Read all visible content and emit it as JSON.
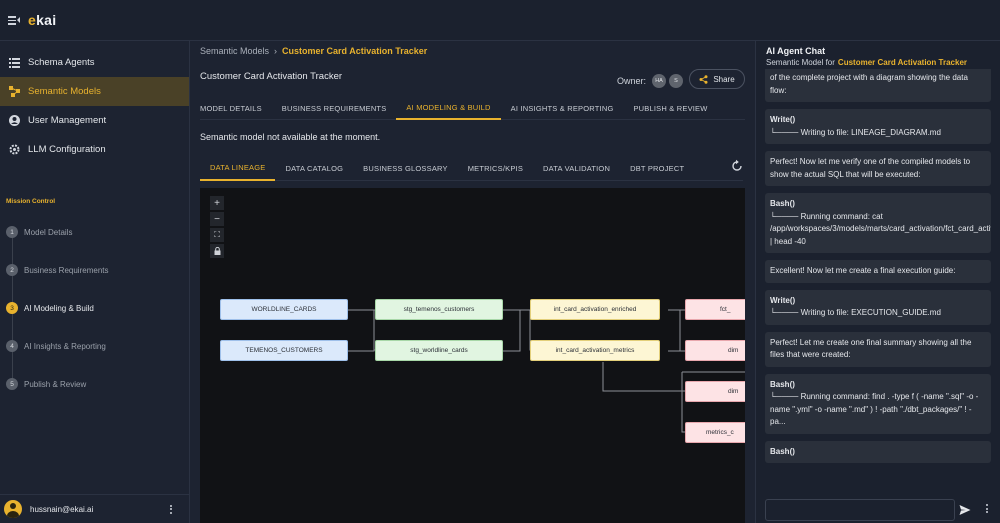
{
  "app": {
    "logo_e": "e",
    "logo_rest": "kai"
  },
  "sidebar": {
    "items": [
      {
        "label": "Schema Agents",
        "icon": "list-icon"
      },
      {
        "label": "Semantic Models",
        "icon": "nodes-icon",
        "active": true
      },
      {
        "label": "User Management",
        "icon": "user-icon"
      },
      {
        "label": "LLM Configuration",
        "icon": "gear-icon"
      }
    ],
    "mission_title": "Mission Control",
    "steps": [
      {
        "num": "1",
        "label": "Model Details"
      },
      {
        "num": "2",
        "label": "Business Requirements"
      },
      {
        "num": "3",
        "label": "AI Modeling & Build",
        "active": true
      },
      {
        "num": "4",
        "label": "AI Insights & Reporting"
      },
      {
        "num": "5",
        "label": "Publish & Review"
      }
    ],
    "user_email": "hussnain@ekai.ai"
  },
  "breadcrumb": {
    "root": "Semantic Models",
    "sep": "›",
    "current": "Customer Card Activation Tracker"
  },
  "page": {
    "title": "Customer Card Activation Tracker",
    "owner_label": "Owner:",
    "owner_chips": [
      "HA",
      "S"
    ],
    "share_label": "Share",
    "tabs": [
      "MODEL DETAILS",
      "BUSINESS REQUIREMENTS",
      "AI MODELING & BUILD",
      "AI INSIGHTS & REPORTING",
      "PUBLISH & REVIEW"
    ],
    "active_tab": 2,
    "notice": "Semantic model not available at the moment.",
    "subtabs": [
      "DATA LINEAGE",
      "DATA CATALOG",
      "BUSINESS GLOSSARY",
      "METRICS/KPIS",
      "DATA VALIDATION",
      "DBT PROJECT"
    ],
    "active_subtab": 0
  },
  "lineage": {
    "zoom_in": "+",
    "zoom_out": "−",
    "fit": "⛶",
    "lock": "🔒",
    "nodes": [
      {
        "id": "n1",
        "label": "WORLDLINE_CARDS",
        "kind": "source"
      },
      {
        "id": "n2",
        "label": "TEMENOS_CUSTOMERS",
        "kind": "source"
      },
      {
        "id": "n3",
        "label": "stg_temenos_customers",
        "kind": "staging"
      },
      {
        "id": "n4",
        "label": "stg_worldline_cards",
        "kind": "staging"
      },
      {
        "id": "n5",
        "label": "int_card_activation_enriched",
        "kind": "intermediate"
      },
      {
        "id": "n6",
        "label": "int_card_activation_metrics",
        "kind": "intermediate"
      },
      {
        "id": "n7",
        "label": "fct_",
        "kind": "mart"
      },
      {
        "id": "n8",
        "label": "dim",
        "kind": "mart"
      },
      {
        "id": "n9",
        "label": "dim",
        "kind": "mart"
      },
      {
        "id": "n10",
        "label": "metrics_c",
        "kind": "mart"
      }
    ]
  },
  "chat": {
    "title": "AI Agent Chat",
    "subtitle": "Semantic Model for",
    "model_name": "Customer Card Activation Tracker",
    "messages": [
      {
        "type": "text",
        "text": "of the complete project with a diagram showing the data flow:"
      },
      {
        "type": "tool",
        "tool": "Write()",
        "text": "└──── Writing to file: LINEAGE_DIAGRAM.md"
      },
      {
        "type": "text",
        "text": "Perfect! Now let me verify one of the compiled models to show the actual SQL that will be executed:"
      },
      {
        "type": "tool",
        "tool": "Bash()",
        "text": "└──── Running command: cat /app/workspaces/3/models/marts/card_activation/fct_card_activation.sql | head -40"
      },
      {
        "type": "text",
        "text": "Excellent! Now let me create a final execution guide:"
      },
      {
        "type": "tool",
        "tool": "Write()",
        "text": "└──── Writing to file: EXECUTION_GUIDE.md"
      },
      {
        "type": "text",
        "text": "Perfect! Let me create one final summary showing all the files that were created:"
      },
      {
        "type": "tool",
        "tool": "Bash()",
        "text": "└──── Running command: find . -type f ( -name \".sql\" -o -name \".yml\" -o -name \".md\" ) ! -path \"./dbt_packages/\" ! -pa..."
      },
      {
        "type": "tool",
        "tool": "Bash()",
        "text": ""
      }
    ],
    "input_placeholder": ""
  },
  "colors": {
    "accent": "#e8b22e",
    "bg": "#1d2331",
    "canvas": "#111215"
  }
}
